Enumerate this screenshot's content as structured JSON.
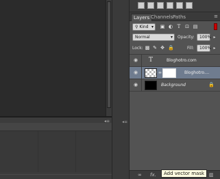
{
  "panel_tabs": [
    "Layers",
    "Channels",
    "Paths"
  ],
  "filter": {
    "kind": "Kind"
  },
  "blend": {
    "mode": "Normal",
    "opacity_label": "Opacity:",
    "opacity_value": "100%"
  },
  "lock": {
    "label": "Lock:",
    "fill_label": "Fill:",
    "fill_value": "100%"
  },
  "layers": [
    {
      "name": "Bloghotro.com",
      "type": "text",
      "selected": false
    },
    {
      "name": "Bloghotro....",
      "type": "masked",
      "selected": true
    },
    {
      "name": "Background",
      "type": "background",
      "selected": false,
      "locked": true
    }
  ],
  "bottom_bar": {
    "link_icon": "link-icon",
    "fx_label": "fx."
  },
  "tooltip": "Add vector mask",
  "icons": {
    "eye": "eye-icon",
    "lock": "lock-icon",
    "menu": "panel-menu-icon"
  }
}
